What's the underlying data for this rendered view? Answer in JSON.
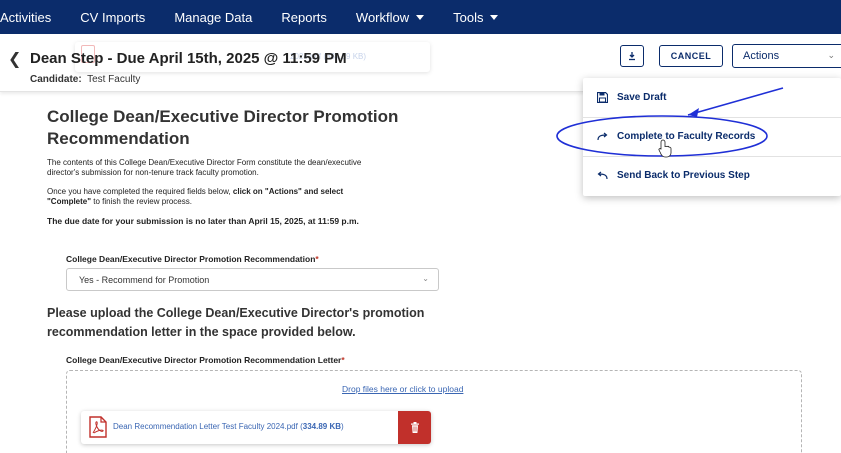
{
  "nav": {
    "items": [
      {
        "label": "Activities",
        "dropdown": false
      },
      {
        "label": "CV Imports",
        "dropdown": false
      },
      {
        "label": "Manage Data",
        "dropdown": false
      },
      {
        "label": "Reports",
        "dropdown": false
      },
      {
        "label": "Workflow",
        "dropdown": true
      },
      {
        "label": "Tools",
        "dropdown": true
      }
    ],
    "background": "#0b2c6b"
  },
  "header": {
    "title": "Dean Step - Due April 15th, 2025 @ 11:59 PM",
    "ghost_file_text": "2024.pdf (334.89 KB)",
    "candidate_label": "Candidate:",
    "candidate_value": "Test Faculty",
    "cancel_label": "CANCEL",
    "actions_label": "Actions"
  },
  "actions_menu": {
    "items": [
      {
        "label": "Save Draft",
        "icon": "save-icon"
      },
      {
        "label": "Complete to Faculty Records",
        "icon": "forward-arrow-icon"
      },
      {
        "label": "Send Back to Previous Step",
        "icon": "back-arrow-icon"
      }
    ]
  },
  "form": {
    "title": "College Dean/Executive Director Promotion Recommendation",
    "intro": "The contents of this College Dean/Executive Director Form constitute the dean/executive director's submission for non-tenure track faculty promotion.",
    "instr_prefix": "Once you have completed the required fields below, ",
    "instr_bold1": "click on \"Actions\" and select \"Complete\"",
    "instr_suffix": " to finish the review process.",
    "due_note": "The due date for your submission is no later than April 15, 2025, at 11:59 p.m.",
    "rec_label": "College Dean/Executive Director Promotion Recommendation",
    "rec_value": "Yes - Recommend for Promotion",
    "upload_heading": "Please upload the College Dean/Executive Director's promotion recommendation letter in the space provided below.",
    "letter_label": "College Dean/Executive Director Promotion Recommendation Letter",
    "required_mark": "*",
    "drop_text": "Drop files here or click to upload",
    "file_name": "Dean Recommendation Letter Test Faculty 2024.pdf",
    "file_size": "334.89 KB"
  },
  "colors": {
    "brand": "#0b2c6b",
    "link": "#3a66b3",
    "danger": "#c1302b",
    "annotation": "#1f2fd6"
  }
}
